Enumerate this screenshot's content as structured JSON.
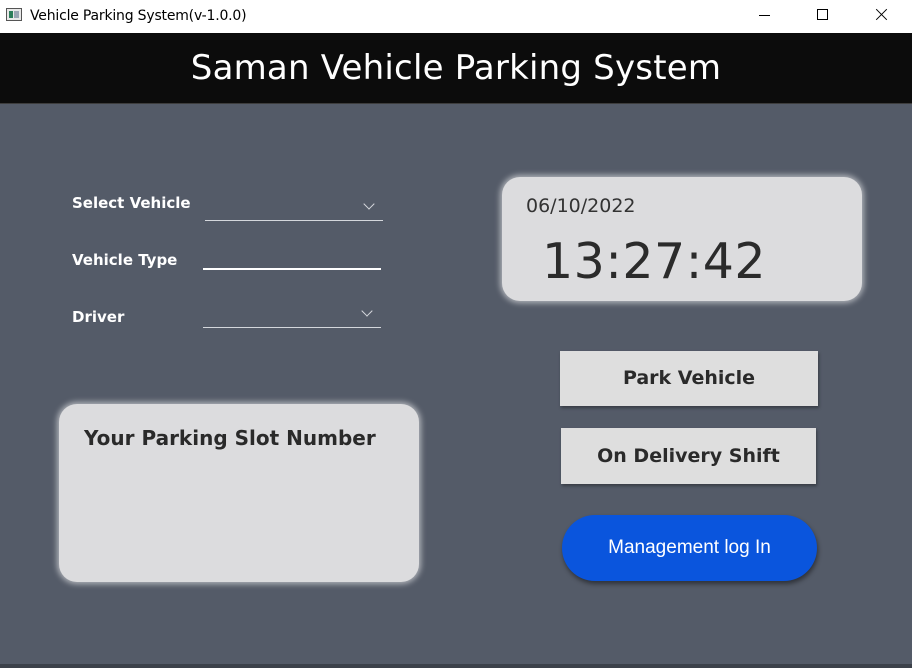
{
  "window": {
    "title": "Vehicle Parking System(v-1.0.0)",
    "controls": [
      "minimize",
      "maximize",
      "close"
    ]
  },
  "header": {
    "title": "Saman Vehicle Parking System"
  },
  "form": {
    "select_vehicle_label": "Select Vehicle",
    "select_vehicle_value": "",
    "vehicle_type_label": "Vehicle Type",
    "vehicle_type_value": "",
    "driver_label": "Driver",
    "driver_value": ""
  },
  "slot_panel": {
    "title": "Your Parking Slot Number",
    "value": ""
  },
  "clock": {
    "date": "06/10/2022",
    "time": "13:27:42"
  },
  "buttons": {
    "park": "Park Vehicle",
    "delivery": "On Delivery Shift",
    "management": "Management log In"
  },
  "colors": {
    "background": "#545b68",
    "header": "#0c0c0c",
    "panel": "#dcdcde",
    "accent": "#0a55dd"
  }
}
